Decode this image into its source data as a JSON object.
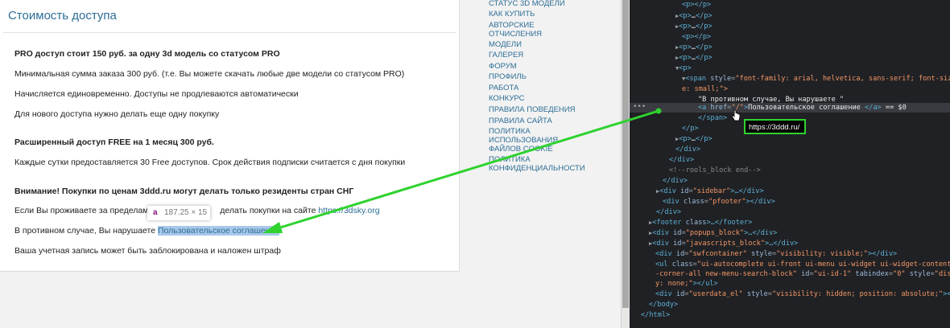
{
  "content": {
    "title": "Стоимость доступа",
    "pro_heading": "PRO доступ стоит 150 руб. за одну 3d модель со статусом PRO",
    "min_order": "Минимальная сумма заказа 300 руб.  (т.е. Вы можете скачать любые две модели со статусом PRO)",
    "one_time": "Начисляется единовременно. Доступы не продлеваются автоматически",
    "new_access": "Для нового доступа нужно делать еще одну покупку",
    "free_heading": "Расширенный доступ FREE на 1 месяц 300 руб.",
    "daily": "Каждые сутки предоставляется 30 Free доступов. Срок действия подписки считается с дня покупки",
    "warning_heading": "Внимание! Покупки по ценам 3ddd.ru могут делать только резиденты стран СНГ",
    "outside_pre": "Если Вы проживаете за пределами",
    "outside_mid": "делать покупки на сайте",
    "outside_link": "https://3dsky.org",
    "otherwise_pre": "В противном случае, Вы нарушаете",
    "agreement_link": "Пользовательское соглашение",
    "penalty": "Ваша учетная запись может быть заблокирована и наложен штраф"
  },
  "element_tooltip": {
    "tag": "a",
    "size": "187.25 × 15"
  },
  "sidebar": {
    "items": [
      "Статус 3D модели",
      "Как купить",
      "Авторские отчисления",
      "Модели",
      "Галерея",
      "Форум",
      "Профиль",
      "Работа",
      "Конкурс",
      "Правила поведения",
      "Правила сайта",
      "Политика использования файлов cookie",
      "Политика конфиденциальности"
    ]
  },
  "devtools": {
    "href_tooltip": "https://3ddd.ru/",
    "lines": [
      [
        "<p>",
        "</p>"
      ],
      [
        "<p>",
        "…",
        "</p>"
      ],
      [
        "<p>",
        "…",
        "</p>"
      ],
      [
        "<p>",
        "</p>"
      ],
      [
        "<p>",
        "…",
        "</p>"
      ],
      [
        "<p>",
        "…",
        "</p>"
      ],
      [
        "<p>"
      ],
      [
        "<span",
        "style",
        "\"font-family: arial, helvetica, sans-serif; font-siz"
      ],
      [
        "e: small;\">"
      ],
      [
        "\"В противном случае, Вы нарушаете \""
      ],
      [
        "<a",
        "href",
        "\"/\"",
        ">",
        "Пользовательское соглашение ",
        "</a>",
        " == $0"
      ],
      [
        "</span>"
      ],
      [
        "</p>"
      ],
      [
        "<p>",
        "…",
        "</p>"
      ],
      [
        "</div>"
      ],
      [
        "</div>"
      ],
      [
        "<!--rools_block end-->"
      ],
      [
        "</div>"
      ],
      [
        "<div",
        "id",
        "\"sidebar\"",
        ">…</div>"
      ],
      [
        "<div",
        "class",
        "\"pfooter\"",
        "></div>"
      ],
      [
        "</div>"
      ],
      [
        "<footer",
        " class",
        ">…</footer>"
      ],
      [
        "<div",
        "id",
        "\"popups_block\"",
        ">…</div>"
      ],
      [
        "<div",
        "id",
        "\"javascripts_block\"",
        ">…</div>"
      ],
      [
        "<div",
        "id",
        "\"swfcontainer\"",
        "style",
        "\"visibility: visible;\"",
        "></div>"
      ],
      [
        "<ul",
        "class",
        "\"ui-autocomplete ui-front ui-menu ui-widget ui-widget-content ui"
      ],
      [
        "-corner-all new-menu-search-block\"",
        "id",
        "\"ui-id-1\"",
        "tabindex",
        "\"0\"",
        "style",
        "\"displa"
      ],
      [
        "y: none;\"",
        "></ul>"
      ],
      [
        "<div",
        "id",
        "\"userdata_el\"",
        "style",
        "\"visibility: hidden; position: absolute;\"",
        "></div>"
      ],
      [
        "</body>"
      ],
      [
        "</html>"
      ]
    ]
  },
  "colors": {
    "accent": "#2d6e96",
    "highlight": "#a8c8ea",
    "arrow": "#2fd22f",
    "devtools_bg": "#202124"
  }
}
